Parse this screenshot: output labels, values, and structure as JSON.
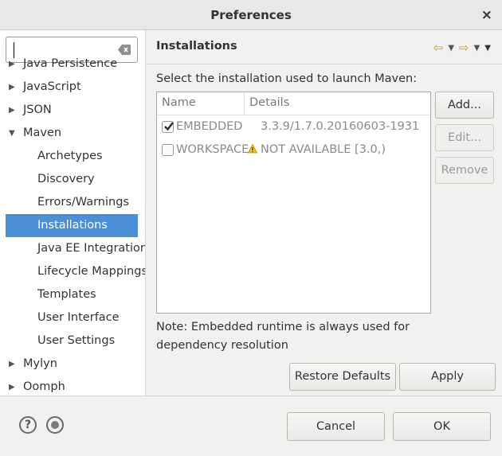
{
  "window": {
    "title": "Preferences",
    "close_glyph": "×"
  },
  "filter": {
    "value": ""
  },
  "tree": {
    "items": [
      {
        "label": "Java Persistence",
        "arrow": "▶",
        "expanded": false
      },
      {
        "label": "JavaScript",
        "arrow": "▶",
        "expanded": false
      },
      {
        "label": "JSON",
        "arrow": "▶",
        "expanded": false
      },
      {
        "label": "Maven",
        "arrow": "▼",
        "expanded": true
      },
      {
        "label": "Archetypes"
      },
      {
        "label": "Discovery"
      },
      {
        "label": "Errors/Warnings"
      },
      {
        "label": "Installations",
        "selected": true
      },
      {
        "label": "Java EE Integration"
      },
      {
        "label": "Lifecycle Mappings"
      },
      {
        "label": "Templates"
      },
      {
        "label": "User Interface"
      },
      {
        "label": "User Settings"
      },
      {
        "label": "Mylyn",
        "arrow": "▶",
        "expanded": false
      },
      {
        "label": "Oomph",
        "arrow": "▶",
        "expanded": false
      }
    ]
  },
  "page": {
    "title": "Installations",
    "nav_back_icon": "arrow-left-icon",
    "nav_forward_icon": "arrow-right-icon",
    "section_label": "Select the installation used to launch Maven:",
    "table": {
      "columns": [
        "Name",
        "Details"
      ],
      "rows": [
        {
          "name": "EMBEDDED",
          "details": "3.3.9/1.7.0.20160603-1931",
          "checked": true,
          "warning": false
        },
        {
          "name": "WORKSPACE",
          "details": "NOT AVAILABLE [3.0,)",
          "checked": false,
          "warning": true
        }
      ]
    },
    "buttons": {
      "add": "Add...",
      "edit": "Edit...",
      "remove": "Remove"
    },
    "note": "Note: Embedded runtime is always used for dependency resolution",
    "restore_defaults": "Restore Defaults",
    "apply": "Apply"
  },
  "footer": {
    "cancel": "Cancel",
    "ok": "OK",
    "help_glyph": "?"
  },
  "colors": {
    "selection": "#4a90d9",
    "warning": "#f5c211",
    "nav_arrows": "#c89a2a"
  }
}
